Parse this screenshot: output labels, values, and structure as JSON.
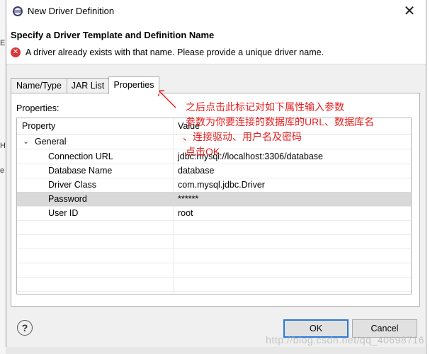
{
  "window": {
    "title": "New Driver Definition"
  },
  "header": {
    "title": "Specify a Driver Template and Definition Name",
    "error": "A driver already exists with that name. Please provide a unique driver name."
  },
  "tabs": [
    {
      "label": "Name/Type"
    },
    {
      "label": "JAR List"
    },
    {
      "label": "Properties",
      "active": true
    }
  ],
  "properties_label": "Properties:",
  "table": {
    "columns": [
      "Property",
      "Value"
    ],
    "group": "General",
    "rows": [
      {
        "property": "Connection URL",
        "value": "jdbc:mysql://localhost:3306/database"
      },
      {
        "property": "Database Name",
        "value": "database"
      },
      {
        "property": "Driver Class",
        "value": "com.mysql.jdbc.Driver"
      },
      {
        "property": "Password",
        "value": "******",
        "selected": true
      },
      {
        "property": "User ID",
        "value": "root"
      }
    ]
  },
  "buttons": {
    "ok": "OK",
    "cancel": "Cancel"
  },
  "annotations": {
    "line1": "之后点击此标记对如下属性输入参数",
    "line2": "参数为你要连接的数据库的URL、数据库名",
    "line3": "、连接驱动、用户名及密码",
    "line4": "点击OK"
  },
  "watermark": "http://blog.csdn.net/qq_40698716",
  "colors": {
    "annotation": "#e81f1f",
    "error": "#d9383a",
    "default_button": "#2a79d8"
  }
}
